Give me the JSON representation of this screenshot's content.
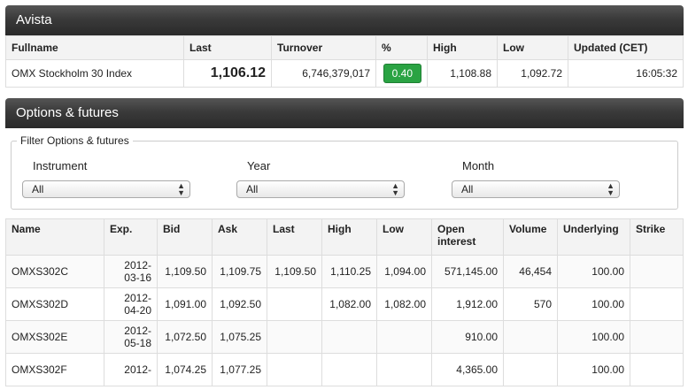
{
  "avista": {
    "title": "Avista",
    "columns": [
      "Fullname",
      "Last",
      "Turnover",
      "%",
      "High",
      "Low",
      "Updated (CET)"
    ],
    "row": {
      "fullname": "OMX Stockholm 30 Index",
      "last": "1,106.12",
      "turnover": "6,746,379,017",
      "pct": "0.40",
      "high": "1,108.88",
      "low": "1,092.72",
      "updated": "16:05:32"
    }
  },
  "options": {
    "title": "Options & futures",
    "filter": {
      "legend": "Filter Options & futures",
      "instrument_label": "Instrument",
      "instrument_value": "All",
      "year_label": "Year",
      "year_value": "All",
      "month_label": "Month",
      "month_value": "All"
    },
    "columns": [
      "Name",
      "Exp.",
      "Bid",
      "Ask",
      "Last",
      "High",
      "Low",
      "Open interest",
      "Volume",
      "Underlying",
      "Strike"
    ],
    "rows": [
      {
        "name": "OMXS302C",
        "exp_y": "2012-",
        "exp_md": "03-16",
        "bid": "1,109.50",
        "ask": "1,109.75",
        "last": "1,109.50",
        "high": "1,110.25",
        "low": "1,094.00",
        "oi": "571,145.00",
        "volume": "46,454",
        "underlying": "100.00",
        "strike": ""
      },
      {
        "name": "OMXS302D",
        "exp_y": "2012-",
        "exp_md": "04-20",
        "bid": "1,091.00",
        "ask": "1,092.50",
        "last": "",
        "high": "1,082.00",
        "low": "1,082.00",
        "oi": "1,912.00",
        "volume": "570",
        "underlying": "100.00",
        "strike": ""
      },
      {
        "name": "OMXS302E",
        "exp_y": "2012-",
        "exp_md": "05-18",
        "bid": "1,072.50",
        "ask": "1,075.25",
        "last": "",
        "high": "",
        "low": "",
        "oi": "910.00",
        "volume": "",
        "underlying": "100.00",
        "strike": ""
      },
      {
        "name": "OMXS302F",
        "exp_y": "2012-",
        "exp_md": "",
        "bid": "1,074.25",
        "ask": "1,077.25",
        "last": "",
        "high": "",
        "low": "",
        "oi": "4,365.00",
        "volume": "",
        "underlying": "100.00",
        "strike": ""
      }
    ]
  }
}
